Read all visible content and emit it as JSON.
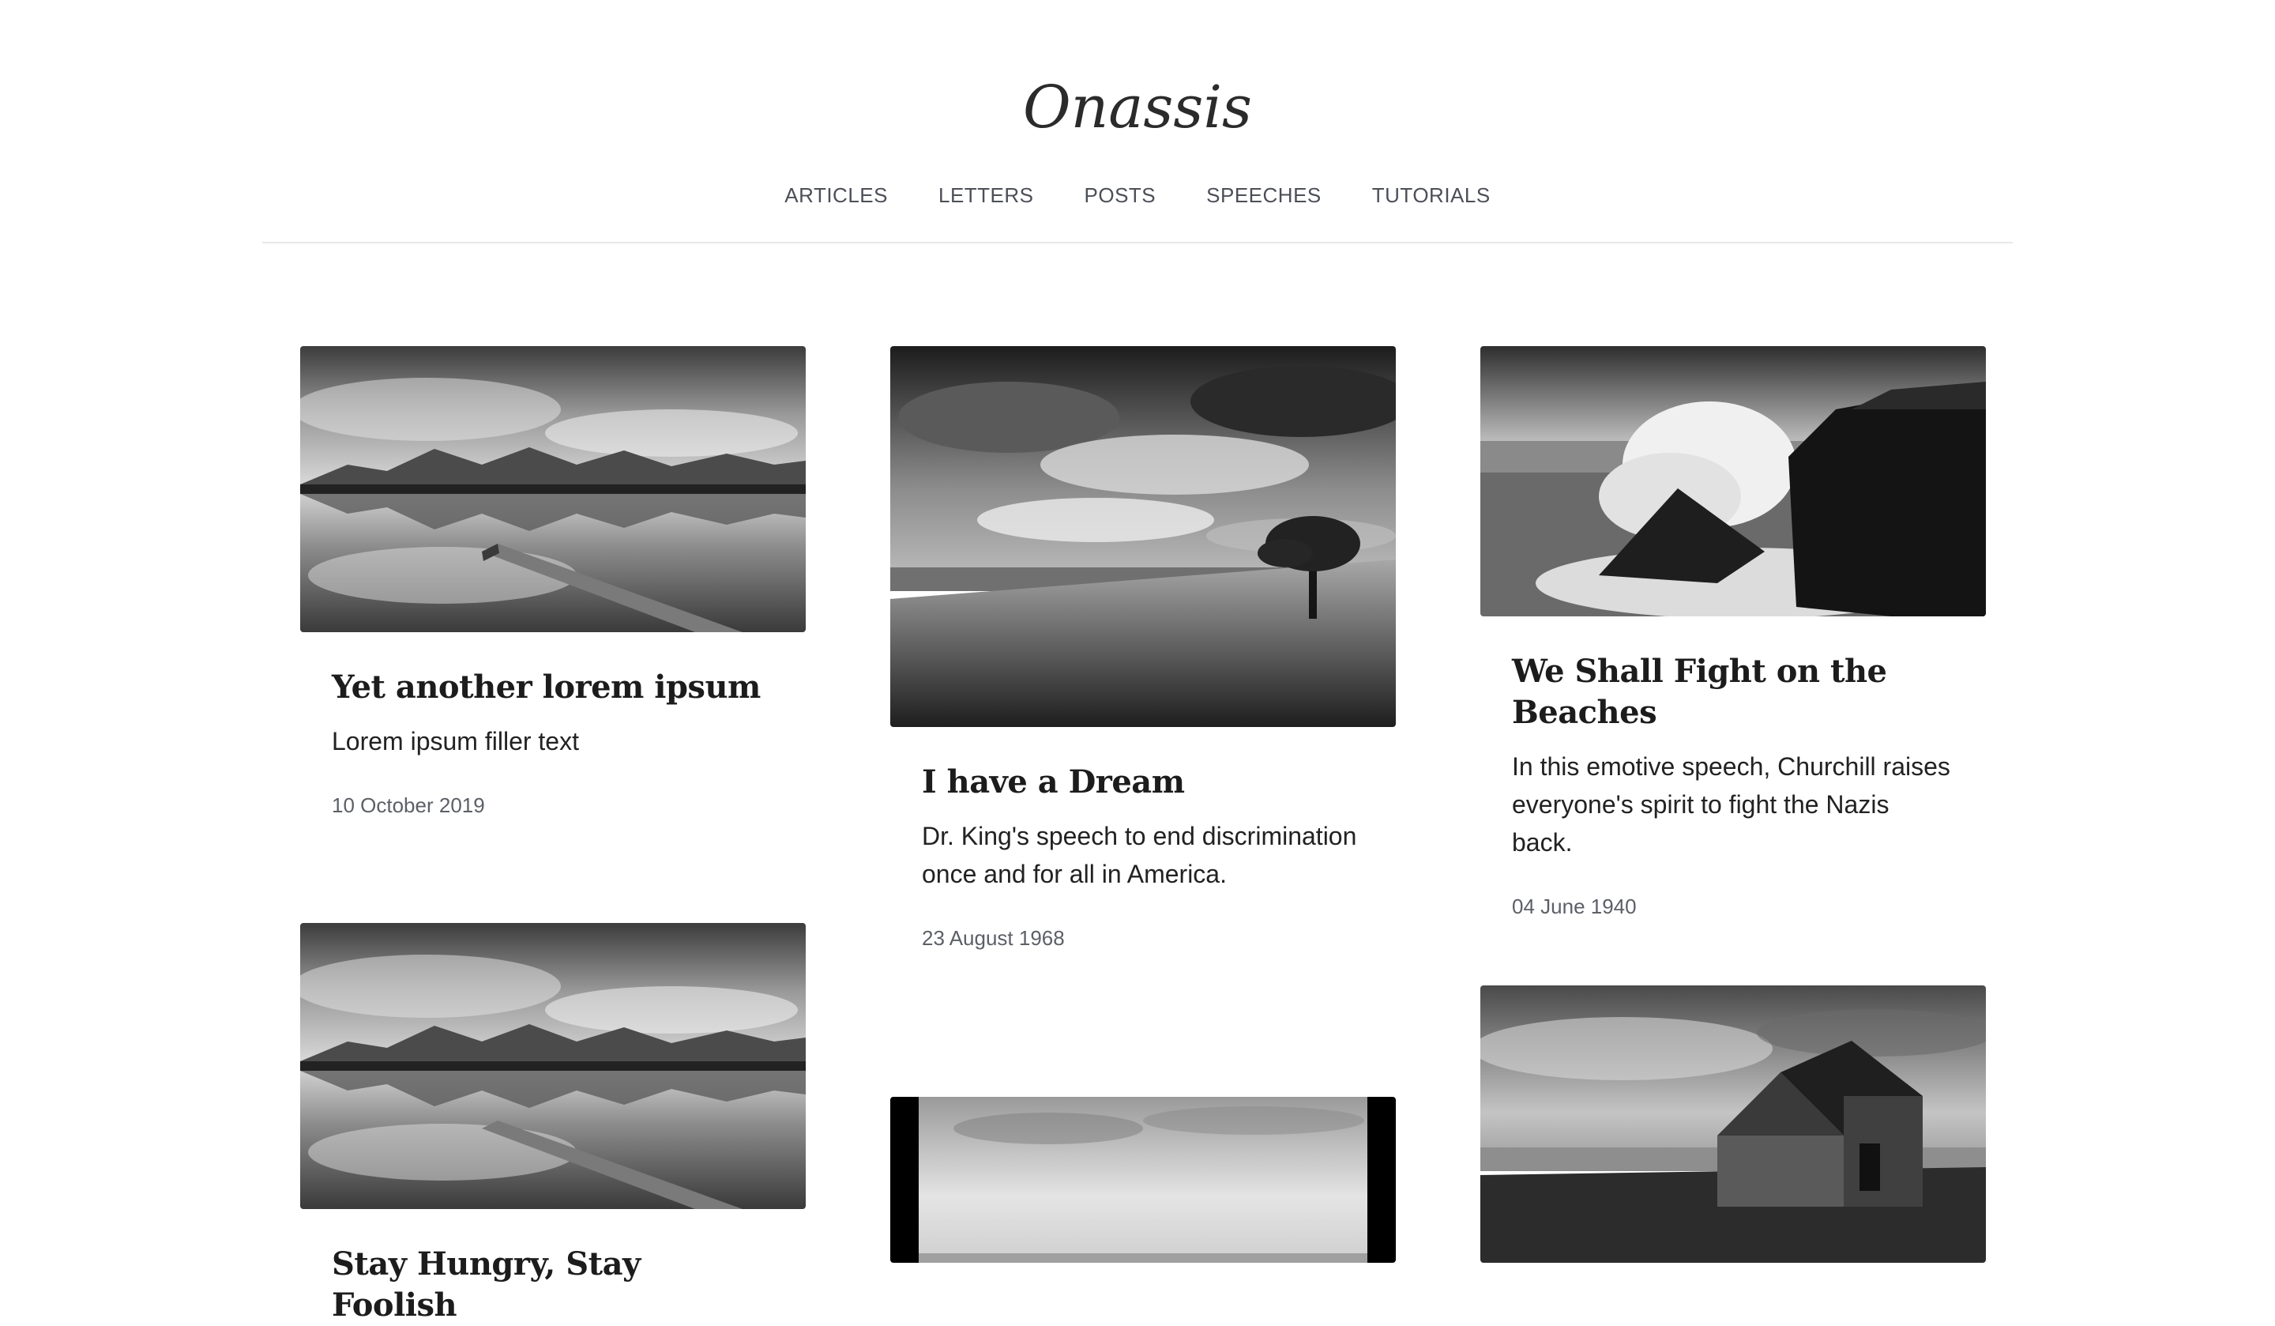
{
  "site": {
    "title": "Onassis"
  },
  "nav": {
    "items": [
      {
        "label": "ARTICLES"
      },
      {
        "label": "LETTERS"
      },
      {
        "label": "POSTS"
      },
      {
        "label": "SPEECHES"
      },
      {
        "label": "TUTORIALS"
      }
    ]
  },
  "posts": [
    {
      "title": "Yet another lorem ipsum",
      "description": "Lorem ipsum filler text",
      "date": "10 October 2019"
    },
    {
      "title": "I have a Dream",
      "description": "Dr. King's speech to end discrimination once and for all in America.",
      "date": "23 August 1968"
    },
    {
      "title": "We Shall Fight on the Beaches",
      "description": "In this emotive speech, Churchill raises everyone's spirit to fight the Nazis back.",
      "date": "04 June 1940"
    },
    {
      "title": "Stay Hungry, Stay Foolish"
    }
  ]
}
